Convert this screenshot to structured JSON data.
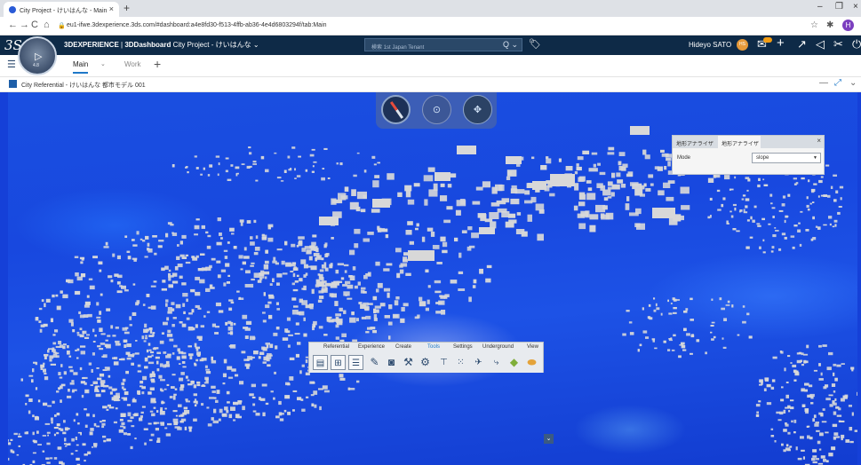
{
  "browser": {
    "tab_title": "City Project - けいはんな - Main",
    "tab_close": "×",
    "new_tab": "+",
    "url": "eu1-ifwe.3dexperience.3ds.com/#dashboard:a4e8fd30-f513-4ffb-ab36-4e4d6803294f/tab:Main",
    "profile_initial": "H",
    "window_buttons": [
      "–",
      "❐",
      "×"
    ],
    "nav": [
      "←",
      "→",
      "C",
      "⌂"
    ],
    "addr_icons": [
      "☆",
      "✱"
    ]
  },
  "app": {
    "logo": "3S",
    "compass_version": "4.8",
    "title_prefix": "3DEXPERIENCE",
    "title_separator": " | ",
    "title_app": "3DDashboard",
    "title_context": " City Project - けいはんな",
    "title_chevron": "⌄",
    "search_placeholder": "検索 1st Japan Tenant",
    "search_icons": "Q ⌄",
    "user_name": "Hideyo SATO",
    "user_initials": "HS",
    "top_icons": [
      "✉",
      "+",
      "↗",
      "◁",
      "✂",
      "⏻"
    ]
  },
  "dashboard": {
    "tabs": [
      {
        "label": "Main",
        "active": true
      },
      {
        "label": "Work",
        "active": false
      }
    ],
    "add_tab": "+"
  },
  "widget": {
    "title": "City Referential - けいはんな 都市モデル 001",
    "icons": [
      "—",
      "⤢",
      "⌄"
    ]
  },
  "terrain_panel": {
    "tabs": [
      "地形アナライザ",
      "地形アナライザ"
    ],
    "close": "×",
    "mode_label": "Mode",
    "mode_value": "slope"
  },
  "action_bar": {
    "tabs": [
      "Referential",
      "Experience",
      "Create",
      "Tools",
      "Settings",
      "Underground",
      "View"
    ],
    "active_tab": "Tools",
    "icons": [
      "table-icon",
      "grid-icon",
      "list-icon",
      "pencil-icon",
      "camera-icon",
      "measure-icon",
      "user-settings-icon",
      "pin-icon",
      "scatter-icon",
      "plane-icon",
      "route-icon",
      "terrain-icon",
      "ellipse-icon"
    ]
  },
  "colors": {
    "terrain": "#1848df",
    "appbar": "#0e2a47",
    "buildings": "#d8d8d8",
    "accent": "#1e78c8"
  }
}
